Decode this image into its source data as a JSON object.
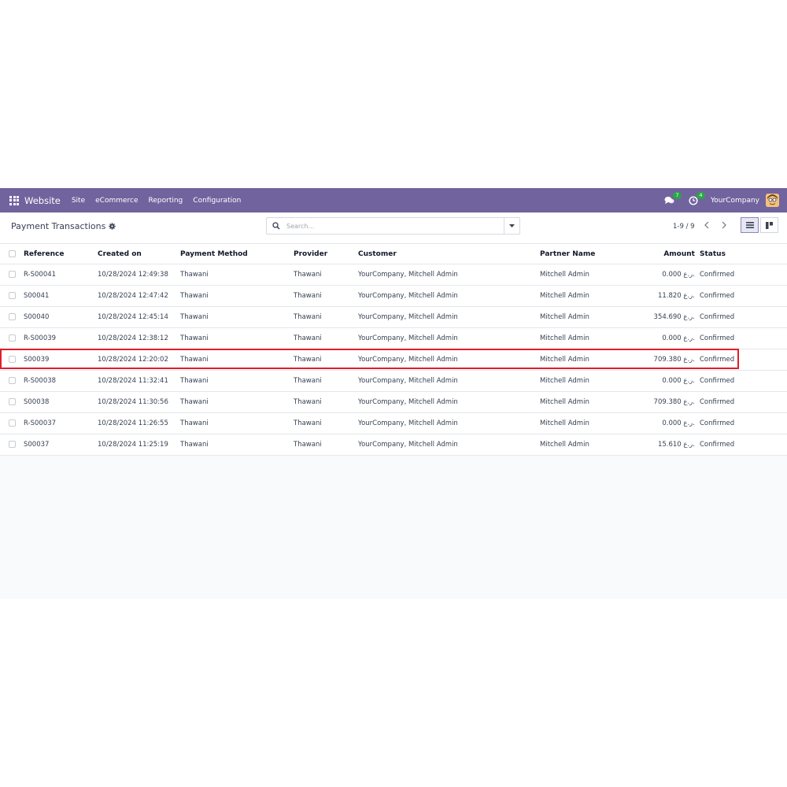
{
  "navbar": {
    "brand": "Website",
    "menu": [
      "Site",
      "eCommerce",
      "Reporting",
      "Configuration"
    ],
    "messages_badge": "7",
    "activities_badge": "4",
    "company": "YourCompany",
    "colors": {
      "navbar": "#71639e",
      "badge": "#28a745"
    }
  },
  "control": {
    "title": "Payment Transactions",
    "search_placeholder": "Search...",
    "pager": "1-9 / 9"
  },
  "table": {
    "columns": {
      "reference": "Reference",
      "created_on": "Created on",
      "payment_method": "Payment Method",
      "provider": "Provider",
      "customer": "Customer",
      "partner_name": "Partner Name",
      "amount": "Amount",
      "status": "Status"
    },
    "rows": [
      {
        "reference": "R-S00041",
        "created_on": "10/28/2024 12:49:38",
        "payment_method": "Thawani",
        "provider": "Thawani",
        "customer": "YourCompany, Mitchell Admin",
        "partner_name": "Mitchell Admin",
        "amount": "0.000 ر.ع.",
        "status": "Confirmed"
      },
      {
        "reference": "S00041",
        "created_on": "10/28/2024 12:47:42",
        "payment_method": "Thawani",
        "provider": "Thawani",
        "customer": "YourCompany, Mitchell Admin",
        "partner_name": "Mitchell Admin",
        "amount": "11.820 ر.ع.",
        "status": "Confirmed"
      },
      {
        "reference": "S00040",
        "created_on": "10/28/2024 12:45:14",
        "payment_method": "Thawani",
        "provider": "Thawani",
        "customer": "YourCompany, Mitchell Admin",
        "partner_name": "Mitchell Admin",
        "amount": "354.690 ر.ع.",
        "status": "Confirmed"
      },
      {
        "reference": "R-S00039",
        "created_on": "10/28/2024 12:38:12",
        "payment_method": "Thawani",
        "provider": "Thawani",
        "customer": "YourCompany, Mitchell Admin",
        "partner_name": "Mitchell Admin",
        "amount": "0.000 ر.ع.",
        "status": "Confirmed"
      },
      {
        "reference": "S00039",
        "created_on": "10/28/2024 12:20:02",
        "payment_method": "Thawani",
        "provider": "Thawani",
        "customer": "YourCompany, Mitchell Admin",
        "partner_name": "Mitchell Admin",
        "amount": "709.380 ر.ع.",
        "status": "Confirmed",
        "highlighted": true
      },
      {
        "reference": "R-S00038",
        "created_on": "10/28/2024 11:32:41",
        "payment_method": "Thawani",
        "provider": "Thawani",
        "customer": "YourCompany, Mitchell Admin",
        "partner_name": "Mitchell Admin",
        "amount": "0.000 ر.ع.",
        "status": "Confirmed"
      },
      {
        "reference": "S00038",
        "created_on": "10/28/2024 11:30:56",
        "payment_method": "Thawani",
        "provider": "Thawani",
        "customer": "YourCompany, Mitchell Admin",
        "partner_name": "Mitchell Admin",
        "amount": "709.380 ر.ع.",
        "status": "Confirmed"
      },
      {
        "reference": "R-S00037",
        "created_on": "10/28/2024 11:26:55",
        "payment_method": "Thawani",
        "provider": "Thawani",
        "customer": "YourCompany, Mitchell Admin",
        "partner_name": "Mitchell Admin",
        "amount": "0.000 ر.ع.",
        "status": "Confirmed"
      },
      {
        "reference": "S00037",
        "created_on": "10/28/2024 11:25:19",
        "payment_method": "Thawani",
        "provider": "Thawani",
        "customer": "YourCompany, Mitchell Admin",
        "partner_name": "Mitchell Admin",
        "amount": "15.610 ر.ع.",
        "status": "Confirmed"
      }
    ],
    "highlight_color": "#e11d2a"
  }
}
